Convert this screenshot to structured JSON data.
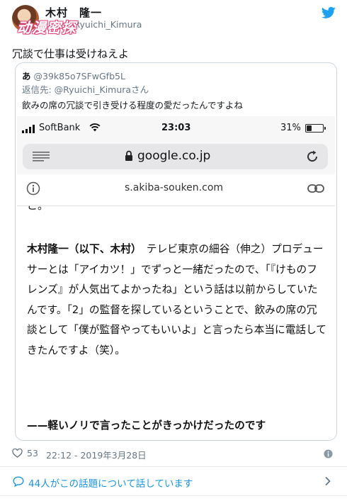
{
  "tweet": {
    "author_name": "木村　隆一",
    "handle": "@Ryuichi_Kimura",
    "watermark": "动漫密探",
    "text": "冗談で仕事は受けねえよ",
    "likes": "53",
    "datetime": "22:12 - 2019年3月28日",
    "conversation_link": "44人がこの話題について話しています"
  },
  "quoted": {
    "author": "あ",
    "handle": "@39k85o7SFwGfb5L",
    "reply_to": "返信先: @Ryuichi_Kimuraさん",
    "text": "飲みの席の冗談で引き受ける程度の愛だったんですよね"
  },
  "phone": {
    "carrier": "SoftBank",
    "time": "23:03",
    "battery": "31%",
    "battery_level": 0.31,
    "url": "google.co.jp",
    "site": "s.akiba-souken.com"
  },
  "article": {
    "clipped_line": "こ。",
    "speaker": "木村隆一（以下、木村）",
    "body": "　テレビ東京の細谷（伸之）プロデューサーとは「アイカツ！」でずっと一緒だったので、「『けものフレンズ』が人気出てよかったね」という話は以前からしていたんです。「2」の監督を探しているということで、飲みの席の冗談として「僕が監督やってもいいよ」と言ったら本当に電話してきたんですよ（笑）。",
    "question": "——軽いノリで言ったことがきっかけだったのです"
  },
  "colors": {
    "twitter_blue": "#1da1f2",
    "link_blue": "#1b95e0",
    "muted": "#657786"
  }
}
